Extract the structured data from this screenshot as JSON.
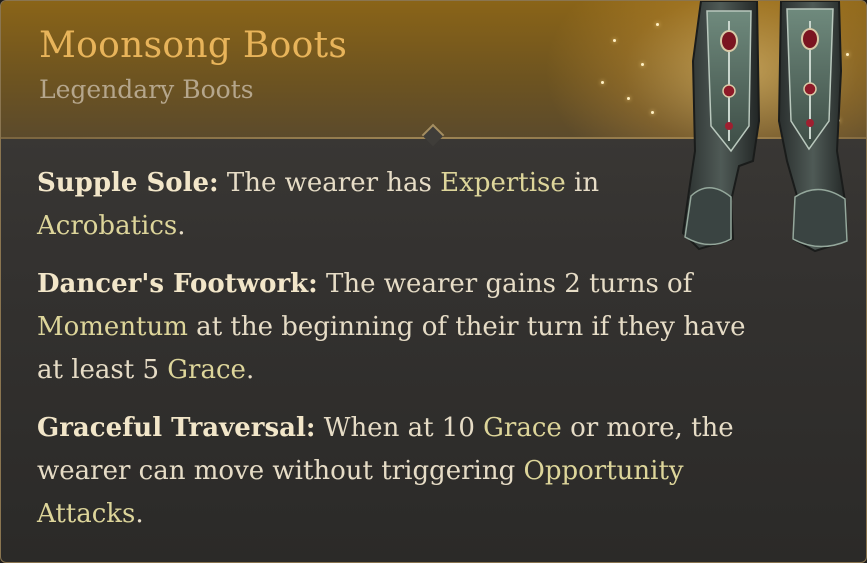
{
  "item": {
    "name": "Moonsong Boots",
    "rarity": "Legendary Boots",
    "icon": "moonsong-boots-icon"
  },
  "colors": {
    "name": "#e8b45a",
    "keyword": "#ddd59a",
    "body_text": "#e6dcc6",
    "header_gold": "#8a6418"
  },
  "properties": [
    {
      "name": "Supple Sole:",
      "t1": " The wearer has ",
      "k1": "Expertise",
      "t2": " in ",
      "k2": "Acrobatics",
      "t3": "."
    },
    {
      "name": "Dancer's Footwork:",
      "t1": " The wearer gains 2 turns of ",
      "k1": "Momentum",
      "t2": " at the beginning of their turn if they have at least 5 ",
      "k2": "Grace",
      "t3": "."
    },
    {
      "name": "Graceful Traversal:",
      "t1": " When at 10 ",
      "k1": "Grace",
      "t2": " or more, the wearer can move without triggering ",
      "k2": "Opportunity Attacks",
      "t3": "."
    }
  ]
}
